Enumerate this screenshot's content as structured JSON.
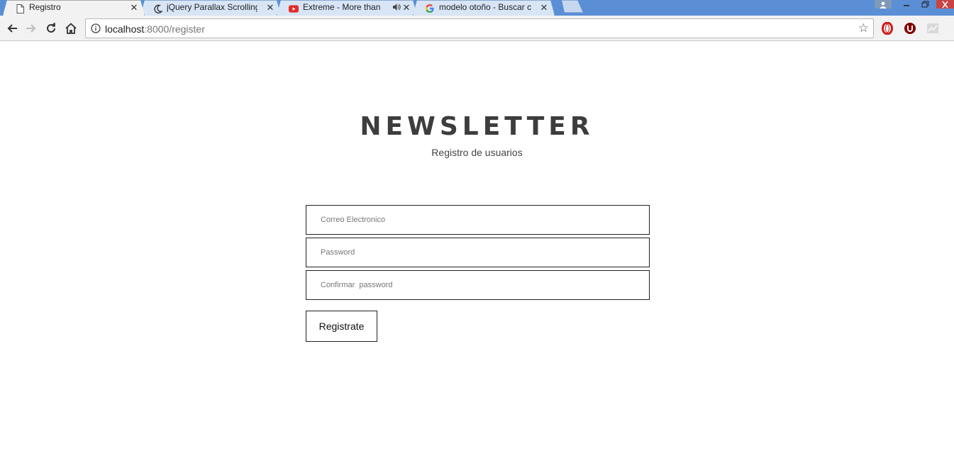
{
  "browser": {
    "tabs": [
      {
        "title": "Registro",
        "icon": "page-icon",
        "active": true
      },
      {
        "title": "jQuery Parallax Scrolling",
        "icon": "moon-icon",
        "active": false
      },
      {
        "title": "Extreme - More than",
        "icon": "youtube-icon",
        "active": false,
        "audio": true
      },
      {
        "title": "modelo otoño - Buscar c",
        "icon": "google-icon",
        "active": false
      }
    ],
    "close_glyph": "✕",
    "address": {
      "host": "localhost",
      "rest": ":8000/register"
    }
  },
  "page": {
    "title": "NEWSLETTER",
    "subtitle": "Registro de usuarios",
    "form": {
      "email_placeholder": "Correo Electronico",
      "password_placeholder": "Password",
      "confirm_placeholder": "Confirmar  password",
      "submit_label": "Registrate"
    }
  },
  "colors": {
    "title": "#3d3d3d",
    "field_border": "#222222",
    "opera_red": "#cc1b1b",
    "ublock_red": "#800000"
  }
}
